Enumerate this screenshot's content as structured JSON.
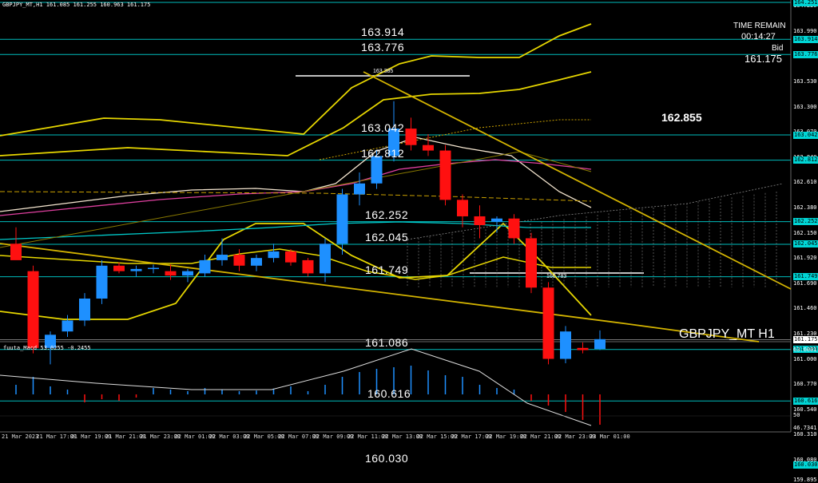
{
  "header": {
    "chart_info": "GBPJPY_MT,H1  161.085 161.255 160.963 161.175",
    "top_level": "164.251",
    "time_remain_label": "TIME REMAIN",
    "time_remain_value": "00:14:27",
    "bid_label": "Bid",
    "bid_value": "161.175",
    "big_price": "162.855",
    "symbol_watermark": "GBPJPY_MT H1"
  },
  "levels": [
    "163.914",
    "163.776",
    "163.042",
    "162.812",
    "162.252",
    "162.045",
    "161.749",
    "161.086",
    "160.616",
    "160.030"
  ],
  "peak_label": "163.385",
  "low_label": "160.783",
  "price_axis": {
    "labels": [
      "164.680",
      "164.450",
      "164.220",
      "163.990",
      "163.760",
      "163.530",
      "163.300",
      "163.070",
      "162.840",
      "162.610",
      "162.380",
      "162.150",
      "161.920",
      "161.690",
      "161.460",
      "161.230",
      "161.000",
      "160.770",
      "160.540",
      "160.310",
      "160.080",
      "159.895"
    ],
    "tags": [
      "164.251",
      "163.914",
      "163.776",
      "163.042",
      "162.812",
      "162.252",
      "162.045",
      "161.749",
      "161.175",
      "161.086",
      "160.616",
      "160.030"
    ],
    "macd_labels": [
      "63.6001",
      "50",
      "46.7341"
    ]
  },
  "macd": {
    "label": "fuuta_Macd 53.0255  -0.2455"
  },
  "time_axis": [
    "21 Mar 2023",
    "21 Mar 17:00",
    "21 Mar 19:00",
    "21 Mar 21:00",
    "21 Mar 23:00",
    "22 Mar 01:00",
    "22 Mar 03:00",
    "22 Mar 05:00",
    "22 Mar 07:00",
    "22 Mar 09:00",
    "22 Mar 11:00",
    "22 Mar 13:00",
    "22 Mar 15:00",
    "22 Mar 17:00",
    "22 Mar 19:00",
    "22 Mar 21:00",
    "22 Mar 23:00",
    "23 Mar 01:00"
  ],
  "candles": [
    {
      "o": 162.05,
      "h": 162.2,
      "l": 161.95,
      "c": 161.9
    },
    {
      "o": 161.8,
      "h": 161.85,
      "l": 161.05,
      "c": 161.1
    },
    {
      "o": 161.1,
      "h": 161.25,
      "l": 160.95,
      "c": 161.22
    },
    {
      "o": 161.25,
      "h": 161.4,
      "l": 161.2,
      "c": 161.35
    },
    {
      "o": 161.35,
      "h": 161.6,
      "l": 161.3,
      "c": 161.55
    },
    {
      "o": 161.55,
      "h": 161.9,
      "l": 161.5,
      "c": 161.85
    },
    {
      "o": 161.85,
      "h": 161.88,
      "l": 161.78,
      "c": 161.8
    },
    {
      "o": 161.8,
      "h": 161.85,
      "l": 161.75,
      "c": 161.82
    },
    {
      "o": 161.82,
      "h": 161.86,
      "l": 161.78,
      "c": 161.83
    },
    {
      "o": 161.8,
      "h": 161.86,
      "l": 161.72,
      "c": 161.76
    },
    {
      "o": 161.76,
      "h": 161.82,
      "l": 161.7,
      "c": 161.8
    },
    {
      "o": 161.78,
      "h": 161.95,
      "l": 161.75,
      "c": 161.9
    },
    {
      "o": 161.9,
      "h": 162.1,
      "l": 161.85,
      "c": 161.95
    },
    {
      "o": 161.95,
      "h": 162.0,
      "l": 161.8,
      "c": 161.85
    },
    {
      "o": 161.85,
      "h": 161.95,
      "l": 161.8,
      "c": 161.92
    },
    {
      "o": 161.92,
      "h": 162.05,
      "l": 161.88,
      "c": 161.98
    },
    {
      "o": 161.98,
      "h": 162.0,
      "l": 161.85,
      "c": 161.88
    },
    {
      "o": 161.9,
      "h": 161.92,
      "l": 161.75,
      "c": 161.78
    },
    {
      "o": 161.78,
      "h": 162.1,
      "l": 161.7,
      "c": 162.05
    },
    {
      "o": 162.05,
      "h": 162.55,
      "l": 161.95,
      "c": 162.5
    },
    {
      "o": 162.5,
      "h": 162.7,
      "l": 162.4,
      "c": 162.6
    },
    {
      "o": 162.6,
      "h": 162.9,
      "l": 162.55,
      "c": 162.85
    },
    {
      "o": 162.85,
      "h": 163.35,
      "l": 162.8,
      "c": 163.1
    },
    {
      "o": 163.1,
      "h": 163.2,
      "l": 162.9,
      "c": 162.95
    },
    {
      "o": 162.95,
      "h": 163.05,
      "l": 162.85,
      "c": 162.9
    },
    {
      "o": 162.9,
      "h": 162.95,
      "l": 162.4,
      "c": 162.45
    },
    {
      "o": 162.45,
      "h": 162.5,
      "l": 162.2,
      "c": 162.3
    },
    {
      "o": 162.3,
      "h": 162.4,
      "l": 162.1,
      "c": 162.22
    },
    {
      "o": 162.25,
      "h": 162.3,
      "l": 162.15,
      "c": 162.28
    },
    {
      "o": 162.28,
      "h": 162.32,
      "l": 162.05,
      "c": 162.1
    },
    {
      "o": 162.1,
      "h": 162.15,
      "l": 161.6,
      "c": 161.65
    },
    {
      "o": 161.65,
      "h": 161.7,
      "l": 160.95,
      "c": 161.0
    },
    {
      "o": 161.0,
      "h": 161.3,
      "l": 160.96,
      "c": 161.25
    },
    {
      "o": 161.1,
      "h": 161.15,
      "l": 161.05,
      "c": 161.08
    },
    {
      "o": 161.09,
      "h": 161.26,
      "l": 161.08,
      "c": 161.18
    }
  ],
  "macd_bars": [
    {
      "v": 0.3
    },
    {
      "v": 0.55
    },
    {
      "v": 0.25
    },
    {
      "v": 0.15
    },
    {
      "v": -0.25
    },
    {
      "v": -0.15
    },
    {
      "v": -0.2
    },
    {
      "v": -0.1
    },
    {
      "v": 0.2
    },
    {
      "v": 0.15
    },
    {
      "v": 0.1
    },
    {
      "v": 0.2
    },
    {
      "v": 0.15
    },
    {
      "v": 0.1
    },
    {
      "v": 0.12
    },
    {
      "v": 0.18
    },
    {
      "v": 0.25
    },
    {
      "v": 0.1
    },
    {
      "v": 0.3
    },
    {
      "v": 0.55
    },
    {
      "v": 0.7
    },
    {
      "v": 0.8
    },
    {
      "v": 0.85
    },
    {
      "v": 0.9
    },
    {
      "v": 0.75
    },
    {
      "v": 0.6
    },
    {
      "v": 0.55
    },
    {
      "v": 0.3
    },
    {
      "v": 0.2
    },
    {
      "v": 0.15
    },
    {
      "v": -0.2
    },
    {
      "v": -0.35
    },
    {
      "v": -0.55
    },
    {
      "v": -0.8
    },
    {
      "v": -0.95
    }
  ],
  "colors": {
    "bull": "#1e90ff",
    "bear": "#ff1010",
    "level": "#00bcbc",
    "band": "#e6d600",
    "trend": "#d4b400"
  }
}
